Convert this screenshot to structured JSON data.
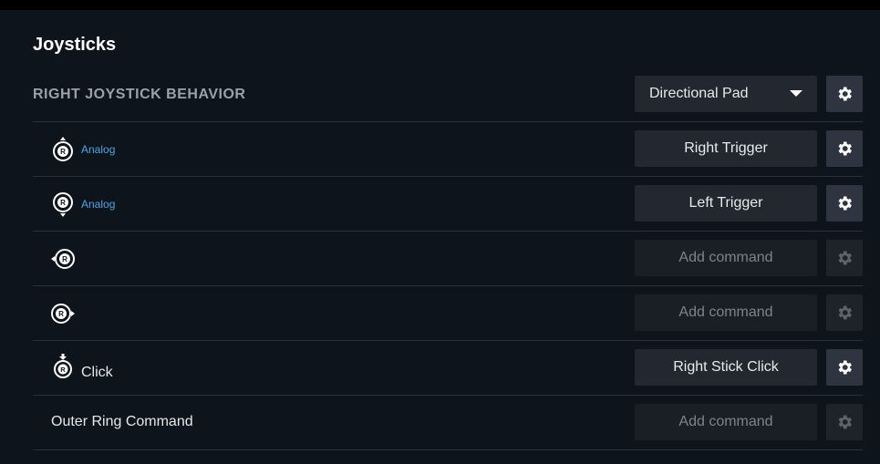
{
  "panel": {
    "title": "Joysticks"
  },
  "behavior": {
    "label": "RIGHT JOYSTICK BEHAVIOR",
    "selected_mode": "Directional Pad"
  },
  "rows": [
    {
      "icon": "right-stick-up-icon",
      "sub_label": "Analog",
      "command": "Right Trigger",
      "empty": false
    },
    {
      "icon": "right-stick-down-icon",
      "sub_label": "Analog",
      "command": "Left Trigger",
      "empty": false
    },
    {
      "icon": "right-stick-left-icon",
      "sub_label": "",
      "command": "Add command",
      "empty": true
    },
    {
      "icon": "right-stick-right-icon",
      "sub_label": "",
      "command": "Add command",
      "empty": true
    },
    {
      "icon": "right-stick-click-icon",
      "sub_label": "Click",
      "command": "Right Stick Click",
      "empty": false
    },
    {
      "label": "Outer Ring Command",
      "command": "Add command",
      "empty": true
    }
  ],
  "colors": {
    "background": "#0e141b",
    "button": "#23272f",
    "accent_analog": "#4fa3e3",
    "muted_text": "#7c838b"
  }
}
